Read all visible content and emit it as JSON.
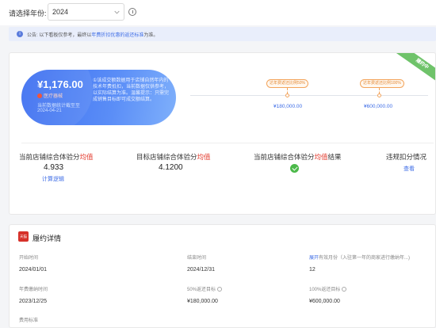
{
  "filter": {
    "label": "请选择年份:",
    "year": "2024"
  },
  "notice": {
    "prefix": "公告:",
    "text_before": "以下看板仅参考，最终以",
    "link": "年费折扣优惠的返还标准",
    "text_after": "为准。"
  },
  "banner": {
    "ribbon": "履约中",
    "amount": "¥1,176.00",
    "brand": "医疗器械",
    "note": "当前数据统计截至至",
    "date": "2024-04-21",
    "desc": "①该成交额数据用于店铺自然年内的技术年费抵扣，当前数据仅供参考，以实际结算为准。温馨提示：只需完成销售目标即可成交额结算。"
  },
  "timeline": {
    "milestones": [
      {
        "tag": "达年费返还比例50%",
        "amount": "¥180,000.00"
      },
      {
        "tag": "达年费返还比例100%",
        "amount": "¥600,000.00"
      }
    ]
  },
  "stats": [
    {
      "label_before": "当前店铺综合体验分",
      "label_red": "均值",
      "value": "4.933",
      "link": "计算逻辑"
    },
    {
      "label_before": "目标店铺综合体验分",
      "label_red": "均值",
      "value": "4.1200"
    },
    {
      "label_before": "当前店铺综合体验分",
      "label_red": "均值",
      "label_after": "结果",
      "result": "check-icon"
    },
    {
      "label_before": "违规扣分情况",
      "link": "查看"
    }
  ],
  "performance": {
    "icon_label": "天猫",
    "title": "履约详情",
    "fields": [
      {
        "label": "开始时间",
        "value": "2024/01/01"
      },
      {
        "label": "结束时间",
        "value": "2024/12/31"
      },
      {
        "label_blue": "展开",
        "label": "有效月份（入驻第一年的商家进行缴纳年...)",
        "value": "12"
      },
      {
        "label": "年费缴纳时间",
        "value": "2023/12/25"
      },
      {
        "label": "50%返还目标",
        "value": "¥180,000.00"
      },
      {
        "label": "100%返还目标",
        "value": "¥600,000.00"
      },
      {
        "label": "费用标准"
      }
    ]
  },
  "colors": {
    "accent": "#3d6ce6",
    "red": "#e33b2e",
    "success": "#4cb94a",
    "milestone": "#f3a45b",
    "ribbon": "#6fc36a"
  }
}
